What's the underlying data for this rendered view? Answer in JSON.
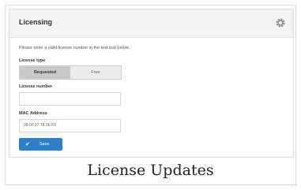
{
  "panel": {
    "title": "Licensing",
    "settings_icon": "gear-icon"
  },
  "form": {
    "instructions": "Please enter a valid license number in the text box below.",
    "license_type": {
      "label": "License type",
      "options": [
        "Requested",
        "Free"
      ],
      "selected": "Requested"
    },
    "license_number": {
      "label": "License number",
      "value": ""
    },
    "mac_address": {
      "label": "MAC Address",
      "value": "08:00:27:78:3E:F0"
    },
    "save_label": "Save",
    "save_icon": "check-icon"
  },
  "caption": "License Updates"
}
